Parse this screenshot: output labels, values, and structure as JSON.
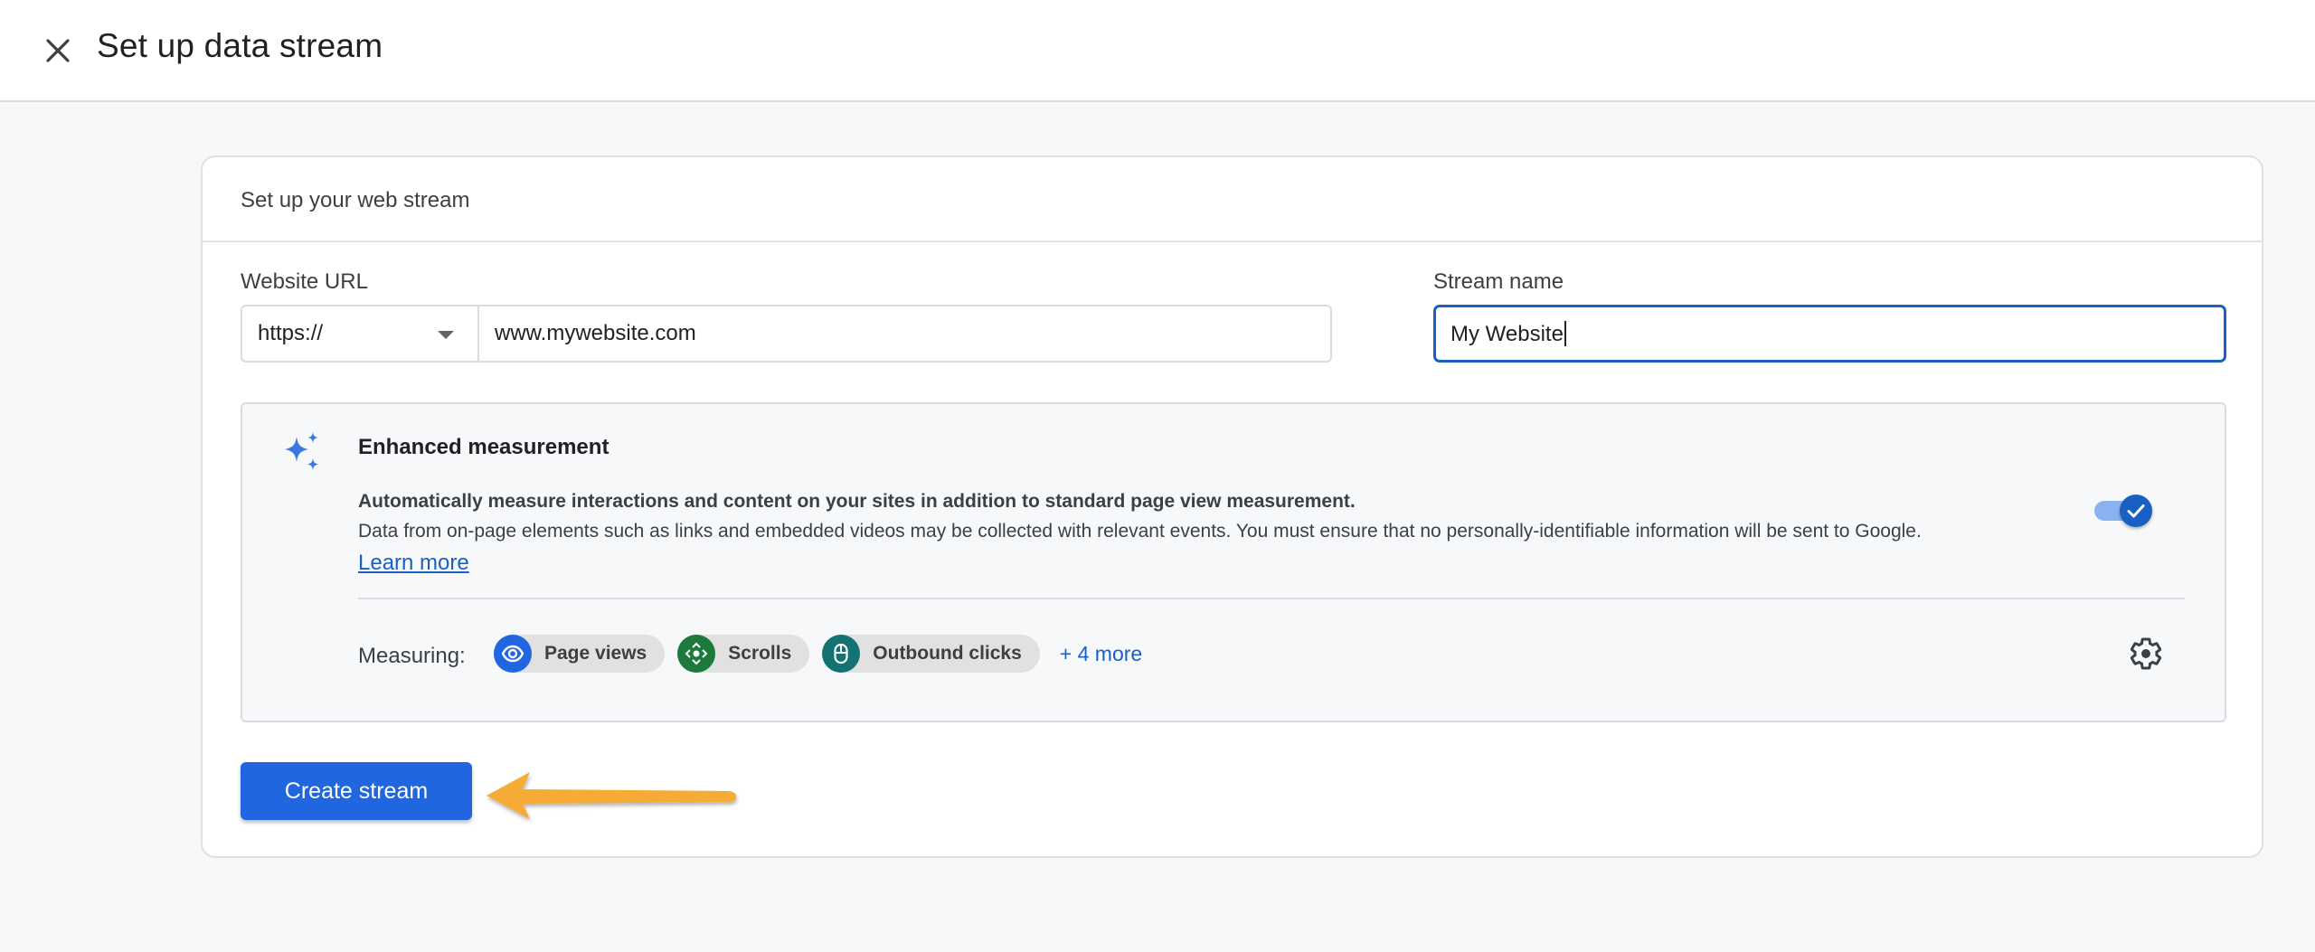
{
  "header": {
    "title": "Set up data stream",
    "close_icon": "close-icon"
  },
  "card": {
    "title": "Set up your web stream",
    "website_url": {
      "label": "Website URL",
      "protocol_selected": "https://",
      "url_value": "www.mywebsite.com"
    },
    "stream_name": {
      "label": "Stream name",
      "value": "My Website"
    },
    "enhanced_measurement": {
      "icon": "sparkle-icon",
      "title": "Enhanced measurement",
      "description_bold": "Automatically measure interactions and content on your sites in addition to standard page view measurement.",
      "description": "Data from on-page elements such as links and embedded videos may be collected with relevant events. You must ensure that no personally-identifiable information will be sent to Google.",
      "learn_more": "Learn more",
      "toggle_enabled": true,
      "measuring_label": "Measuring:",
      "chips": [
        {
          "label": "Page views",
          "icon": "eye-icon",
          "color": "#1f66e0"
        },
        {
          "label": "Scrolls",
          "icon": "scroll-arrows-icon",
          "color": "#1e7a3c"
        },
        {
          "label": "Outbound clicks",
          "icon": "mouse-icon",
          "color": "#137373"
        }
      ],
      "more_link": "+ 4 more",
      "settings_icon": "gear-icon"
    },
    "create_button": "Create stream"
  },
  "annotation": {
    "arrow_color": "#f5ab35"
  },
  "colors": {
    "primary": "#1f66e0",
    "link": "#1a5fc4",
    "background": "#f8f8f8"
  }
}
